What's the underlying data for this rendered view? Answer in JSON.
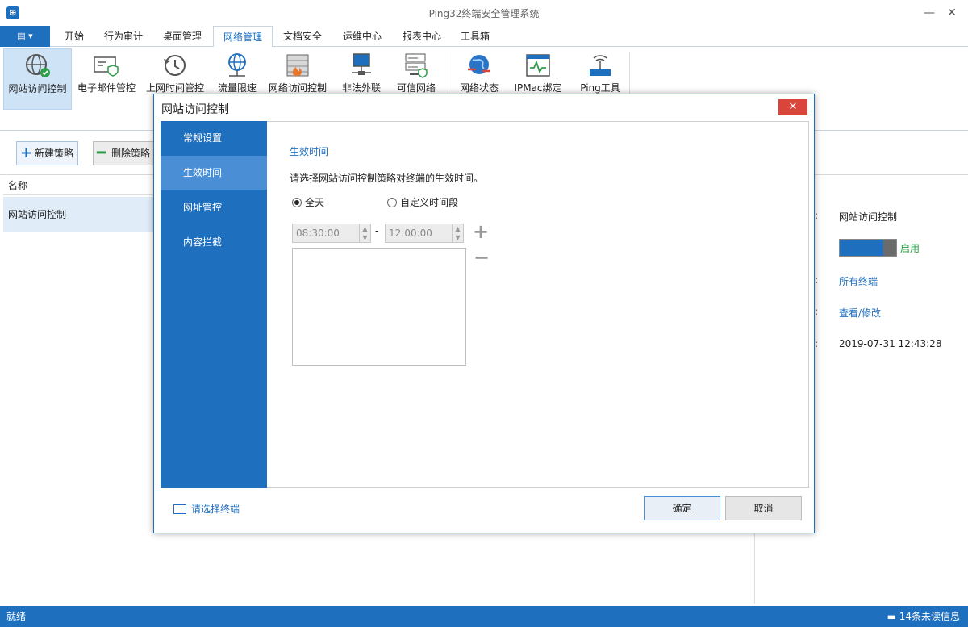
{
  "window": {
    "title": "Ping32终端安全管理系统",
    "minimize": "—",
    "close": "✕"
  },
  "menu": {
    "tabs": [
      "开始",
      "行为审计",
      "桌面管理",
      "网络管理",
      "文档安全",
      "运维中心",
      "报表中心",
      "工具箱"
    ],
    "active_tab": "网络管理"
  },
  "ribbon": {
    "items": [
      "网站访问控制",
      "电子邮件管控",
      "上网时间管控",
      "流量限速",
      "网络访问控制",
      "非法外联",
      "可信网络",
      "网络状态",
      "IPMac绑定",
      "Ping工具"
    ]
  },
  "toolbar": {
    "new_policy": "新建策略",
    "delete_policy": "删除策略"
  },
  "list": {
    "header": "名称",
    "rows": [
      "网站访问控制"
    ]
  },
  "right_panel": {
    "name_value": "网站访问控制",
    "toggle_label": "启用",
    "terminals_value": "所有终端",
    "view_edit": "查看/修改",
    "time_value": "2019-07-31 12:43:28",
    "colon": ":"
  },
  "status": {
    "left": "就绪",
    "right": "14条未读信息"
  },
  "modal": {
    "title": "网站访问控制",
    "nav": [
      "常规设置",
      "生效时间",
      "网址管控",
      "内容拦截"
    ],
    "active_nav": "生效时间",
    "section_title": "生效时间",
    "description": "请选择网站访问控制策略对终端的生效时间。",
    "radio_all_day": "全天",
    "radio_custom": "自定义时间段",
    "start_time": "08:30:00",
    "end_time": "12:00:00",
    "dash": "-",
    "footer_link": "请选择终端",
    "ok": "确定",
    "cancel": "取消"
  }
}
